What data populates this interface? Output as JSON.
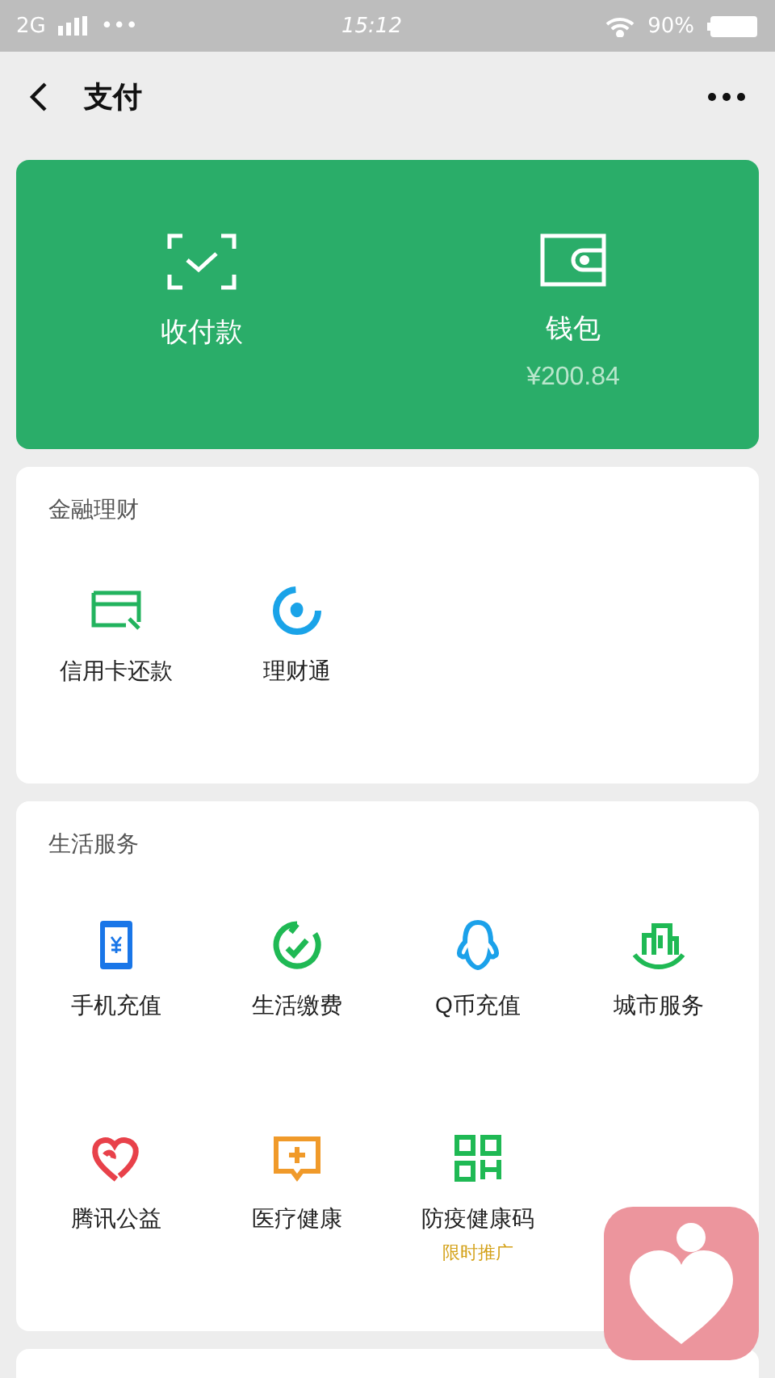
{
  "status_bar": {
    "network": "2G",
    "dots": "•••",
    "time": "15:12",
    "battery": "90%"
  },
  "nav": {
    "title": "支付"
  },
  "hero": [
    {
      "kind": "scan",
      "label": "收付款"
    },
    {
      "kind": "wallet",
      "label": "钱包",
      "amount": "¥200.84"
    }
  ],
  "sections": [
    {
      "title": "金融理财",
      "items": [
        {
          "kind": "card",
          "label": "信用卡还款"
        },
        {
          "kind": "wealth",
          "label": "理财通"
        }
      ]
    },
    {
      "title": "生活服务",
      "items": [
        {
          "kind": "phone",
          "label": "手机充值"
        },
        {
          "kind": "bills",
          "label": "生活缴费"
        },
        {
          "kind": "qq",
          "label": "Q币充值"
        },
        {
          "kind": "city",
          "label": "城市服务"
        },
        {
          "kind": "charity",
          "label": "腾讯公益"
        },
        {
          "kind": "medical",
          "label": "医疗健康"
        },
        {
          "kind": "qrcode",
          "label": "防疫健康码",
          "note": "限时推广"
        }
      ]
    }
  ],
  "floating": {
    "kind": "heart-app"
  }
}
